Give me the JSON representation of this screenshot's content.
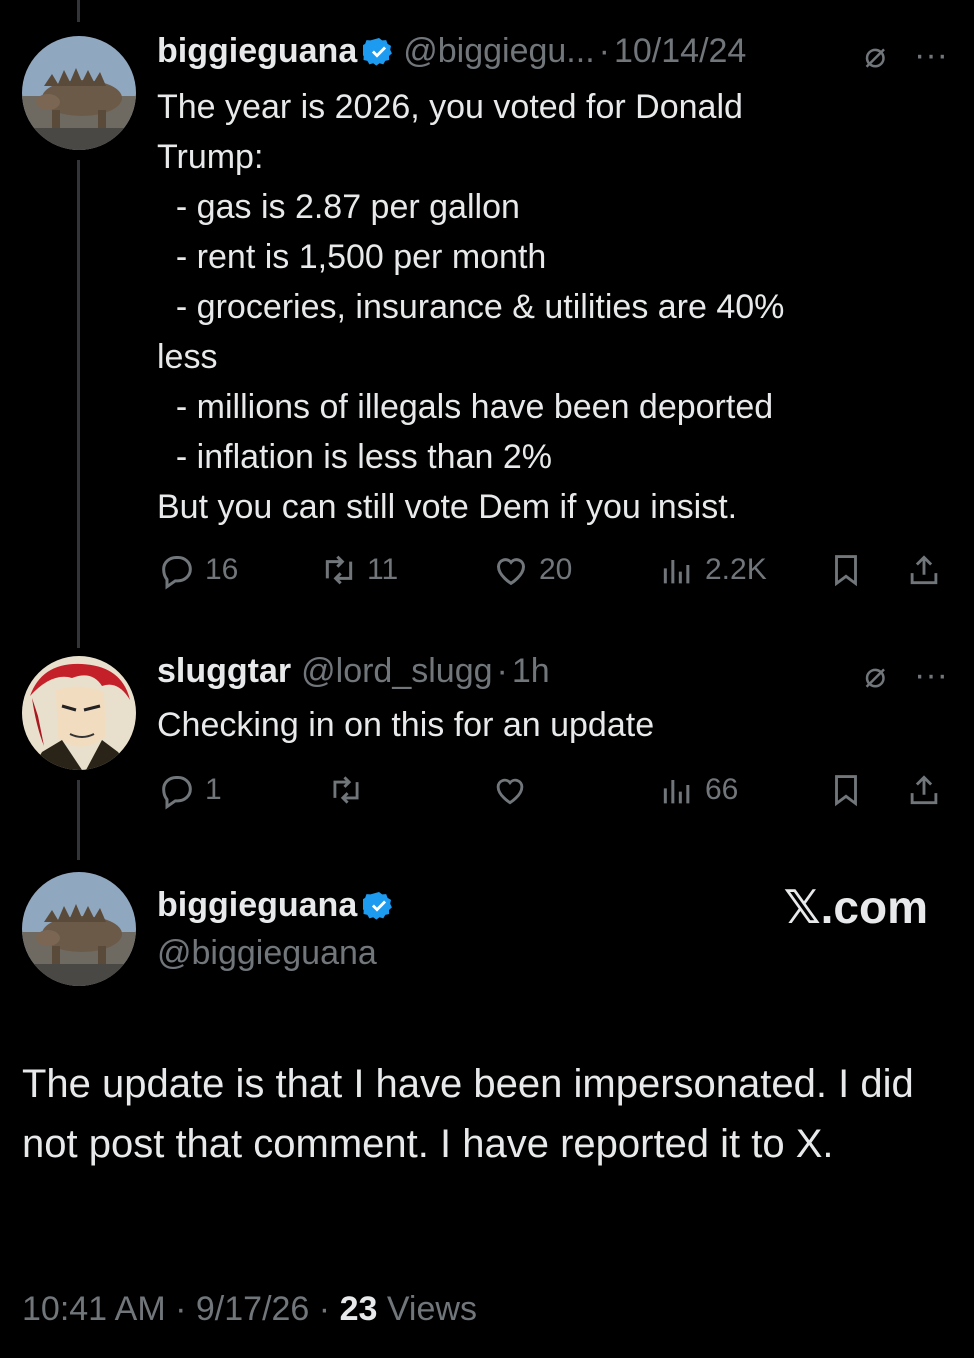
{
  "tweet1": {
    "display_name": "biggieguana",
    "handle": "@biggiegu...",
    "sep": "·",
    "date": "10/14/24",
    "text": "The year is 2026, you voted for Donald\nTrump:\n  - gas is 2.87 per gallon\n  - rent is 1,500 per month\n  - groceries, insurance & utilities are 40%\nless\n  - millions of illegals have been deported\n  - inflation is less than 2%\nBut you can still vote Dem if you insist.",
    "replies": "16",
    "reposts": "11",
    "likes": "20",
    "views": "2.2K"
  },
  "tweet2": {
    "display_name": "sluggtar",
    "handle": "@lord_slugg",
    "sep": "·",
    "time": "1h",
    "text": "Checking in on this for an update",
    "replies": "1",
    "views": "66"
  },
  "tweet3": {
    "display_name": "biggieguana",
    "handle": "@biggieguana",
    "brand": "𝕏.com",
    "text": "The update is that I have been impersonated. I did not post that comment. I have reported it to X.",
    "time": "10:41 AM",
    "sep1": "·",
    "date": "9/17/26",
    "sep2": "·",
    "views_count": "23",
    "views_label": "Views"
  },
  "icons": {
    "more": "···",
    "verified_color": "#1d9bf0",
    "muted_color": "#71767b"
  }
}
